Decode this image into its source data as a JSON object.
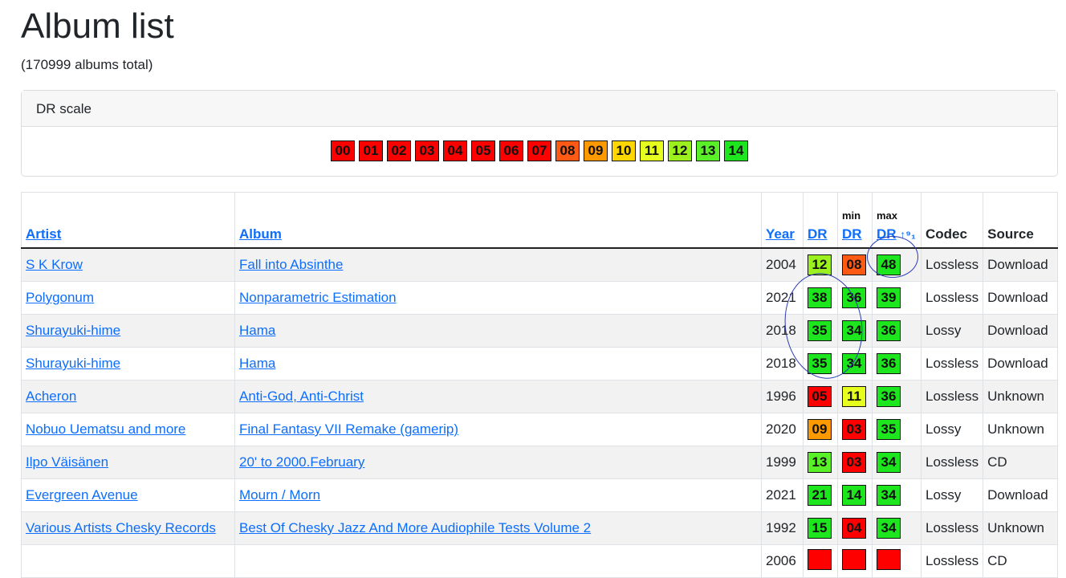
{
  "title": "Album list",
  "total": "(170999 albums total)",
  "scale": {
    "label": "DR scale",
    "values": [
      "00",
      "01",
      "02",
      "03",
      "04",
      "05",
      "06",
      "07",
      "08",
      "09",
      "10",
      "11",
      "12",
      "13",
      "14"
    ]
  },
  "colors": {
    "00": "#ff0000",
    "01": "#ff0000",
    "02": "#ff0000",
    "03": "#ff0000",
    "04": "#ff0000",
    "05": "#ff0000",
    "06": "#ff0000",
    "07": "#ff0000",
    "08": "#ff5a14",
    "09": "#ff9900",
    "10": "#ffd700",
    "11": "#e6ff1e",
    "12": "#9cf01e",
    "13": "#5af028",
    "14": "#1ee61e"
  },
  "headers": {
    "artist": "Artist",
    "album": "Album",
    "year": "Year",
    "dr": "DR",
    "min": "min",
    "min_dr": "DR",
    "max": "max",
    "max_dr": "DR",
    "sort": "↑⁹₁",
    "codec": "Codec",
    "source": "Source"
  },
  "rows": [
    {
      "artist": "S K Krow",
      "album": "Fall into Absinthe",
      "year": "2004",
      "dr": "12",
      "min": "08",
      "max": "48",
      "codec": "Lossless",
      "source": "Download"
    },
    {
      "artist": "Polygonum",
      "album": "Nonparametric Estimation",
      "year": "2021",
      "dr": "38",
      "min": "36",
      "max": "39",
      "codec": "Lossless",
      "source": "Download"
    },
    {
      "artist": "Shurayuki-hime",
      "album": "Hama",
      "year": "2018",
      "dr": "35",
      "min": "34",
      "max": "36",
      "codec": "Lossy",
      "source": "Download"
    },
    {
      "artist": "Shurayuki-hime",
      "album": "Hama",
      "year": "2018",
      "dr": "35",
      "min": "34",
      "max": "36",
      "codec": "Lossless",
      "source": "Download"
    },
    {
      "artist": "Acheron",
      "album": "Anti-God, Anti-Christ",
      "year": "1996",
      "dr": "05",
      "min": "11",
      "max": "36",
      "codec": "Lossless",
      "source": "Unknown"
    },
    {
      "artist": "Nobuo Uematsu and more",
      "album": "Final Fantasy VII Remake (gamerip)",
      "year": "2020",
      "dr": "09",
      "min": "03",
      "max": "35",
      "codec": "Lossy",
      "source": "Unknown"
    },
    {
      "artist": "Ilpo Väisänen",
      "album": "20' to 2000.February",
      "year": "1999",
      "dr": "13",
      "min": "03",
      "max": "34",
      "codec": "Lossless",
      "source": "CD"
    },
    {
      "artist": "Evergreen Avenue",
      "album": "Mourn / Morn",
      "year": "2021",
      "dr": "21",
      "min": "14",
      "max": "34",
      "codec": "Lossy",
      "source": "Download"
    },
    {
      "artist": "Various Artists Chesky Records",
      "album": "Best Of Chesky Jazz And More Audiophile Tests Volume 2",
      "year": "1992",
      "dr": "15",
      "min": "04",
      "max": "34",
      "codec": "Lossless",
      "source": "Unknown"
    },
    {
      "artist": "",
      "album": "",
      "year": "2006",
      "dr": "",
      "min": "",
      "max": "",
      "codec": "Lossless",
      "source": "CD"
    }
  ]
}
